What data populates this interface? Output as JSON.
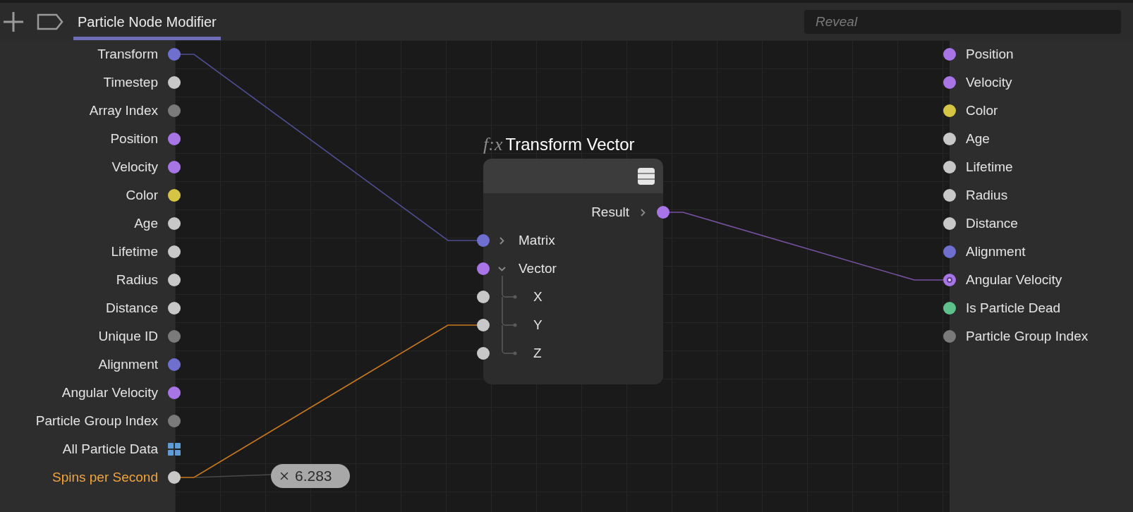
{
  "tab": {
    "label": "Particle Node Modifier",
    "selected": true
  },
  "search": {
    "placeholder": "Reveal"
  },
  "left_ports": [
    {
      "label": "Transform",
      "color": "#6f6fd0",
      "kind": "dot",
      "user_defined": false,
      "wired": true
    },
    {
      "label": "Timestep",
      "color": "#c8c8c8",
      "kind": "dot",
      "user_defined": false
    },
    {
      "label": "Array Index",
      "color": "#7a7a7a",
      "kind": "dot",
      "user_defined": false
    },
    {
      "label": "Position",
      "color": "#a875e6",
      "kind": "dot",
      "user_defined": false
    },
    {
      "label": "Velocity",
      "color": "#a875e6",
      "kind": "dot",
      "user_defined": false
    },
    {
      "label": "Color",
      "color": "#d6c445",
      "kind": "dot",
      "user_defined": false
    },
    {
      "label": "Age",
      "color": "#c8c8c8",
      "kind": "dot",
      "user_defined": false
    },
    {
      "label": "Lifetime",
      "color": "#c8c8c8",
      "kind": "dot",
      "user_defined": false
    },
    {
      "label": "Radius",
      "color": "#c8c8c8",
      "kind": "dot",
      "user_defined": false
    },
    {
      "label": "Distance",
      "color": "#c8c8c8",
      "kind": "dot",
      "user_defined": false
    },
    {
      "label": "Unique ID",
      "color": "#7a7a7a",
      "kind": "dot",
      "user_defined": false
    },
    {
      "label": "Alignment",
      "color": "#6f6fd0",
      "kind": "dot",
      "user_defined": false
    },
    {
      "label": "Angular Velocity",
      "color": "#a875e6",
      "kind": "dot",
      "user_defined": false
    },
    {
      "label": "Particle Group Index",
      "color": "#7a7a7a",
      "kind": "dot",
      "user_defined": false
    },
    {
      "label": "All Particle Data",
      "color": "#5f9bd6",
      "kind": "grid",
      "user_defined": false
    },
    {
      "label": "Spins per Second",
      "color": "#c8c8c8",
      "kind": "dot",
      "user_defined": true,
      "wired": true,
      "multiplier": "6.283"
    }
  ],
  "right_ports": [
    {
      "label": "Position",
      "color": "#a875e6",
      "connected": false
    },
    {
      "label": "Velocity",
      "color": "#a875e6",
      "connected": false
    },
    {
      "label": "Color",
      "color": "#d6c445",
      "connected": false
    },
    {
      "label": "Age",
      "color": "#c8c8c8",
      "connected": false
    },
    {
      "label": "Lifetime",
      "color": "#c8c8c8",
      "connected": false
    },
    {
      "label": "Radius",
      "color": "#c8c8c8",
      "connected": false
    },
    {
      "label": "Distance",
      "color": "#c8c8c8",
      "connected": false
    },
    {
      "label": "Alignment",
      "color": "#6f6fd0",
      "connected": false
    },
    {
      "label": "Angular Velocity",
      "color": "#a875e6",
      "connected": true
    },
    {
      "label": "Is Particle Dead",
      "color": "#5ec08a",
      "connected": false
    },
    {
      "label": "Particle Group Index",
      "color": "#7a7a7a",
      "connected": false
    }
  ],
  "node": {
    "symbol": "f:x",
    "title": "Transform Vector",
    "outputs": [
      {
        "label": "Result",
        "color": "#a875e6",
        "wired": true
      }
    ],
    "inputs": [
      {
        "label": "Matrix",
        "color": "#6f6fd0",
        "expanded": false,
        "wired": true
      },
      {
        "label": "Vector",
        "color": "#a875e6",
        "expanded": true,
        "children": [
          {
            "label": "X",
            "color": "#c8c8c8"
          },
          {
            "label": "Y",
            "color": "#c8c8c8",
            "wired": true
          },
          {
            "label": "Z",
            "color": "#c8c8c8"
          }
        ]
      }
    ]
  }
}
